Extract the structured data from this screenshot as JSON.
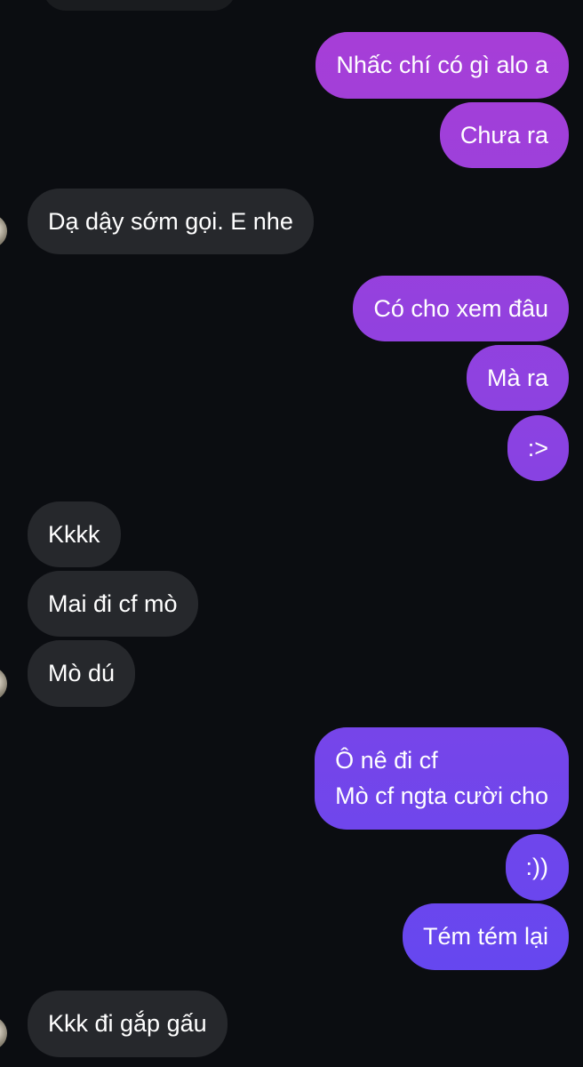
{
  "conversation": {
    "messages": [
      {
        "dir": "out",
        "text": "Nhấc chí có gì alo a"
      },
      {
        "dir": "out",
        "text": "Chưa ra"
      },
      {
        "dir": "in",
        "text": "Dạ dậy sớm gọi. E nhe"
      },
      {
        "dir": "out",
        "text": "Có cho xem đâu"
      },
      {
        "dir": "out",
        "text": "Mà ra"
      },
      {
        "dir": "out",
        "text": ":>"
      },
      {
        "dir": "in",
        "text": "Kkkk"
      },
      {
        "dir": "in",
        "text": "Mai đi cf mò"
      },
      {
        "dir": "in",
        "text": "Mò dú"
      },
      {
        "dir": "out",
        "lines": [
          "Ô nê đi cf",
          "Mò cf ngta cười cho"
        ]
      },
      {
        "dir": "out",
        "text": ":))"
      },
      {
        "dir": "out",
        "text": "Tém tém lại"
      },
      {
        "dir": "in",
        "text": "Kkk đi gắp gấu"
      }
    ]
  },
  "colors": {
    "background": "#0b0d11",
    "incoming_bubble": "#26282c",
    "outgoing_gradient_top": "#a93ed6",
    "outgoing_gradient_bottom": "#5f48f2",
    "text": "#ffffff"
  }
}
